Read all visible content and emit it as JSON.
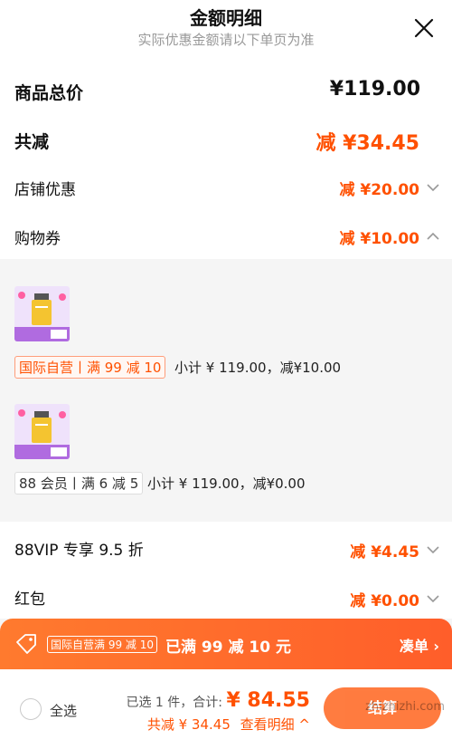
{
  "header": {
    "title": "金额明细",
    "subtitle": "实际优惠金额请以下单页为准"
  },
  "rows": {
    "total_label": "商品总价",
    "total_value": "¥119.00",
    "discount_label": "共减",
    "discount_value": "减 ¥34.45",
    "store_label": "店铺优惠",
    "store_value": "减 ¥20.00",
    "coupon_label": "购物券",
    "coupon_value": "减 ¥10.00",
    "vip_label": "88VIP 专享 9.5 折",
    "vip_value": "减 ¥4.45",
    "redpacket_label": "红包",
    "redpacket_value": "减 ¥0.00"
  },
  "coupon_items": [
    {
      "tag": "国际自营丨满 99 减 10",
      "subtotal": "小计 ¥ 119.00，减¥10.00"
    },
    {
      "tag": "88 会员丨满 6 减 5",
      "subtotal": "小计 ¥ 119.00，减¥0.00"
    }
  ],
  "promo": {
    "tag": "国际自营满 99 减 10",
    "text": "已满 99 减 10 元",
    "action": "凑单 ›"
  },
  "footer": {
    "select_all": "全选",
    "selected": "已选 1 件，合计: ",
    "amount": "¥ 84.55",
    "saved": "共减 ¥ 34.45",
    "details": "查看明细 ^",
    "checkout": "结算",
    "watermark": "zhizhizhi.com"
  },
  "colors": {
    "accent": "#ff5000",
    "promo_bg": "#ff6a2c"
  }
}
